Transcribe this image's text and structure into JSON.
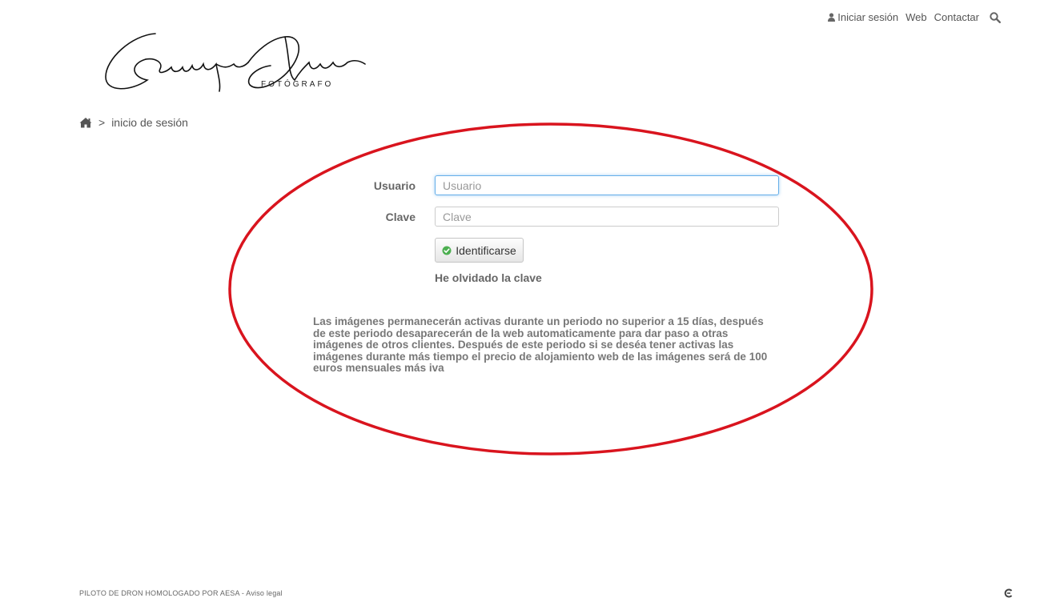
{
  "nav": {
    "login": "Iniciar sesión",
    "web": "Web",
    "contact": "Contactar",
    "user_icon": "user-icon",
    "search_icon": "search-icon"
  },
  "logo": {
    "name": "Enrique Oliver",
    "subtitle": "FOTÓGRAFO"
  },
  "breadcrumb": {
    "home_icon": "home-icon",
    "separator": ">",
    "current": "inicio de sesión"
  },
  "form": {
    "user_label": "Usuario",
    "user_placeholder": "Usuario",
    "pass_label": "Clave",
    "pass_placeholder": "Clave",
    "submit_label": "Identificarse",
    "submit_icon": "check-circle-icon",
    "forgot_label": "He olvidado la clave"
  },
  "notice": "Las imágenes permanecerán activas durante un periodo no superior a 15 días, después de este periodo desaparecerán de la web automaticamente para dar paso a otras imágenes de otros clientes. Después de este periodo si se deséa tener activas las imágenes durante más tiempo el precio de alojamiento web de las imágenes será de 100 euros mensuales más iva",
  "footer": {
    "text": "PILOTO DE DRON HOMOLOGADO POR AESA - ",
    "link": "Aviso legal"
  },
  "colors": {
    "annotation_ellipse": "#d9141e",
    "focus_border": "#66afe9",
    "success_green": "#4caf50"
  }
}
